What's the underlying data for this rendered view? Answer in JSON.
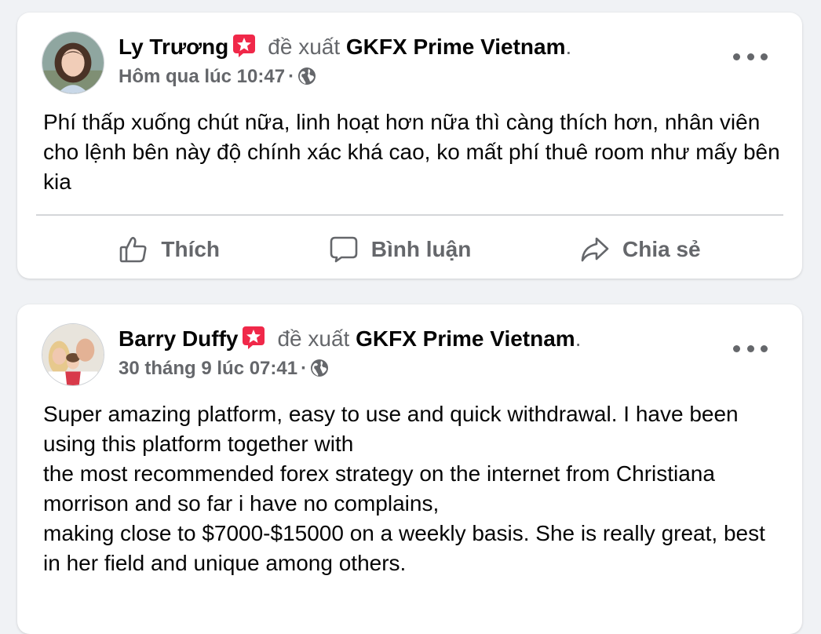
{
  "posts": [
    {
      "author": "Ly Trương",
      "recommends": "đề xuất",
      "page": "GKFX Prime Vietnam",
      "timestamp": "Hôm qua lúc 10:47",
      "text": "Phí thấp xuống chút nữa, linh hoạt hơn nữa thì càng thích hơn, nhân viên cho lệnh bên này độ chính xác khá cao, ko mất phí thuê room như mấy bên kia",
      "actions": {
        "like": "Thích",
        "comment": "Bình luận",
        "share": "Chia sẻ"
      }
    },
    {
      "author": "Barry Duffy",
      "recommends": "đề xuất",
      "page": "GKFX Prime Vietnam",
      "timestamp": "30 tháng 9 lúc 07:41",
      "text": "Super amazing platform, easy to use and quick withdrawal. I have been using this platform together with\nthe most recommended forex strategy on the internet from Christiana morrison and so far i have no complains,\nmaking close to $7000-$15000 on a weekly basis. She is really great, best in her field and unique among others."
    }
  ],
  "separator": "·",
  "period": ".",
  "colors": {
    "background": "#f0f2f5",
    "card": "#ffffff",
    "secondary_text": "#65676b",
    "recommend_badge": "#f02849"
  },
  "icons": {
    "recommend": "recommend-star-icon",
    "privacy": "globe-icon",
    "more": "more-options-icon",
    "like": "thumbs-up-icon",
    "comment": "comment-bubble-icon",
    "share": "share-arrow-icon"
  }
}
